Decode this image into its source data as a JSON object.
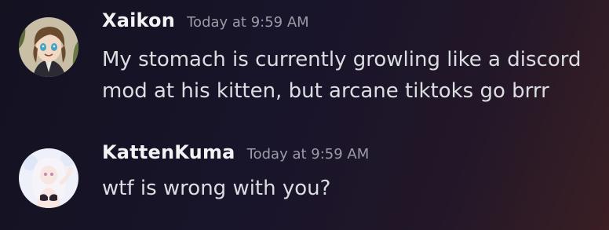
{
  "messages": [
    {
      "username": "Xaikon",
      "timestamp": "Today at 9:59 AM",
      "lines": [
        "My stomach is currently growling like a discord",
        "mod at his kitten, but arcane tiktoks go brrr"
      ]
    },
    {
      "username": "KattenKuma",
      "timestamp": "Today at 9:59 AM",
      "lines": [
        "wtf is wrong with you?"
      ]
    }
  ],
  "colors": {
    "username": "#f2f3f5",
    "timestamp": "#9b9ca6",
    "message_text": "#dbdee1"
  }
}
